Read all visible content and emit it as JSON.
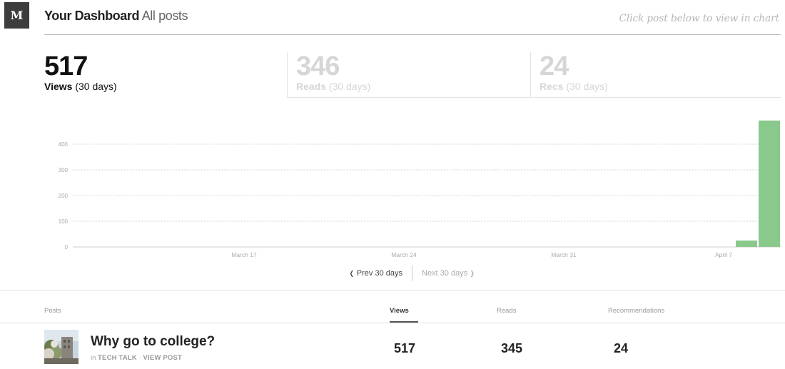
{
  "brand": {
    "logo_letter": "M"
  },
  "header": {
    "title": "Your Dashboard",
    "subtitle": "All posts",
    "hint": "Click post below to view in chart"
  },
  "stats": [
    {
      "value": "517",
      "label": "Views",
      "period": "(30 days)",
      "active": true
    },
    {
      "value": "346",
      "label": "Reads",
      "period": "(30 days)",
      "active": false
    },
    {
      "value": "24",
      "label": "Recs",
      "period": "(30 days)",
      "active": false
    }
  ],
  "chart_data": {
    "type": "bar",
    "title": "",
    "xlabel": "",
    "ylabel": "",
    "ylim": [
      0,
      500
    ],
    "yticks": [
      0,
      100,
      200,
      300,
      400
    ],
    "x_tick_labels": [
      {
        "label": "March 17",
        "day_index": 7
      },
      {
        "label": "March 24",
        "day_index": 14
      },
      {
        "label": "March 31",
        "day_index": 21
      },
      {
        "label": "April 7",
        "day_index": 28
      }
    ],
    "days": 31,
    "series": [
      {
        "values": [
          0,
          0,
          0,
          0,
          0,
          0,
          0,
          0,
          0,
          0,
          0,
          0,
          0,
          0,
          0,
          0,
          0,
          0,
          0,
          0,
          0,
          0,
          0,
          0,
          0,
          0,
          0,
          0,
          0,
          25,
          492
        ]
      }
    ],
    "bar_color": "#8ac98c",
    "grid": true
  },
  "pager": {
    "prev": "Prev 30 days",
    "next": "Next 30 days"
  },
  "table": {
    "headers": {
      "posts": "Posts",
      "views": "Views",
      "reads": "Reads",
      "recs": "Recommendations"
    },
    "rows": [
      {
        "title": "Why go to college?",
        "in_label": "in",
        "publication": "Tech Talk",
        "separator": "·",
        "view_post": "View post",
        "views": "517",
        "reads": "345",
        "recs": "24"
      }
    ]
  }
}
